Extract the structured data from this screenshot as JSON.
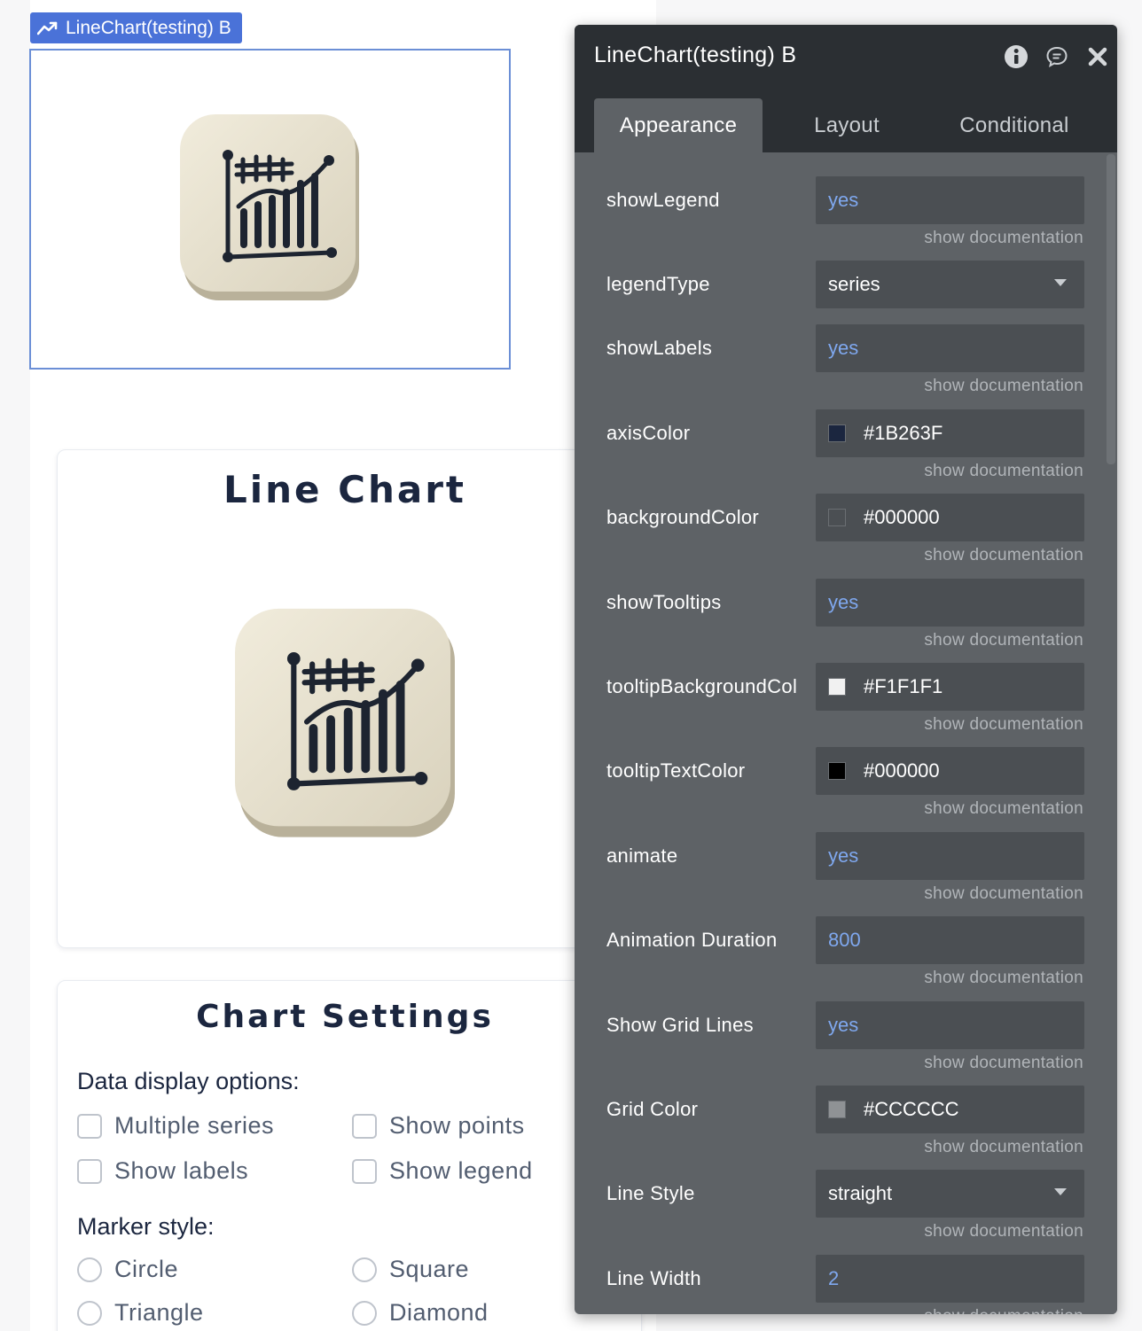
{
  "element_tag": {
    "label": "LineChart(testing) B",
    "icon": "trend-line-icon"
  },
  "chart_card": {
    "title": "Line Chart",
    "icon": "line-chart-app-icon"
  },
  "settings_card": {
    "title": "Chart Settings",
    "data_display_label": "Data display options:",
    "data_options": [
      "Multiple series",
      "Show points",
      "Show labels",
      "Show legend"
    ],
    "marker_label": "Marker style:",
    "marker_options": [
      "Circle",
      "Square",
      "Triangle",
      "Diamond"
    ]
  },
  "panel": {
    "title": "LineChart(testing) B",
    "header_icons": [
      "info-icon",
      "comment-icon",
      "close-icon"
    ],
    "tabs": [
      {
        "label": "Appearance",
        "active": true
      },
      {
        "label": "Layout",
        "active": false
      },
      {
        "label": "Conditional",
        "active": false
      }
    ],
    "doc_link": "show documentation",
    "properties": [
      {
        "label": "showLegend",
        "value": "yes",
        "kind": "yes"
      },
      {
        "label": "legendType",
        "value": "series",
        "kind": "dropdown"
      },
      {
        "label": "showLabels",
        "value": "yes",
        "kind": "yes"
      },
      {
        "label": "axisColor",
        "value": "#1B263F",
        "kind": "color",
        "swatch": "#1B263F"
      },
      {
        "label": "backgroundColor",
        "value": "#000000",
        "kind": "color",
        "swatch": "transparent"
      },
      {
        "label": "showTooltips",
        "value": "yes",
        "kind": "yes"
      },
      {
        "label": "tooltipBackgroundCol",
        "value": "#F1F1F1",
        "kind": "color",
        "swatch": "#F1F1F1"
      },
      {
        "label": "tooltipTextColor",
        "value": "#000000",
        "kind": "color",
        "swatch": "#000000"
      },
      {
        "label": "animate",
        "value": "yes",
        "kind": "yes"
      },
      {
        "label": "Animation Duration",
        "value": "800",
        "kind": "yes"
      },
      {
        "label": "Show Grid Lines",
        "value": "yes",
        "kind": "yes"
      },
      {
        "label": "Grid Color",
        "value": "#CCCCCC",
        "kind": "color",
        "swatch": "#8f9295"
      },
      {
        "label": "Line Style",
        "value": "straight",
        "kind": "dropdown"
      },
      {
        "label": "Line Width",
        "value": "2",
        "kind": "yes"
      }
    ]
  },
  "colors": {
    "accent_blue": "#4a72d8",
    "panel_bg": "#5e6266",
    "panel_header": "#2b2f33",
    "field_bg": "#4b4f53",
    "yes_value": "#7fa8ef",
    "title_text": "#1b263f"
  }
}
